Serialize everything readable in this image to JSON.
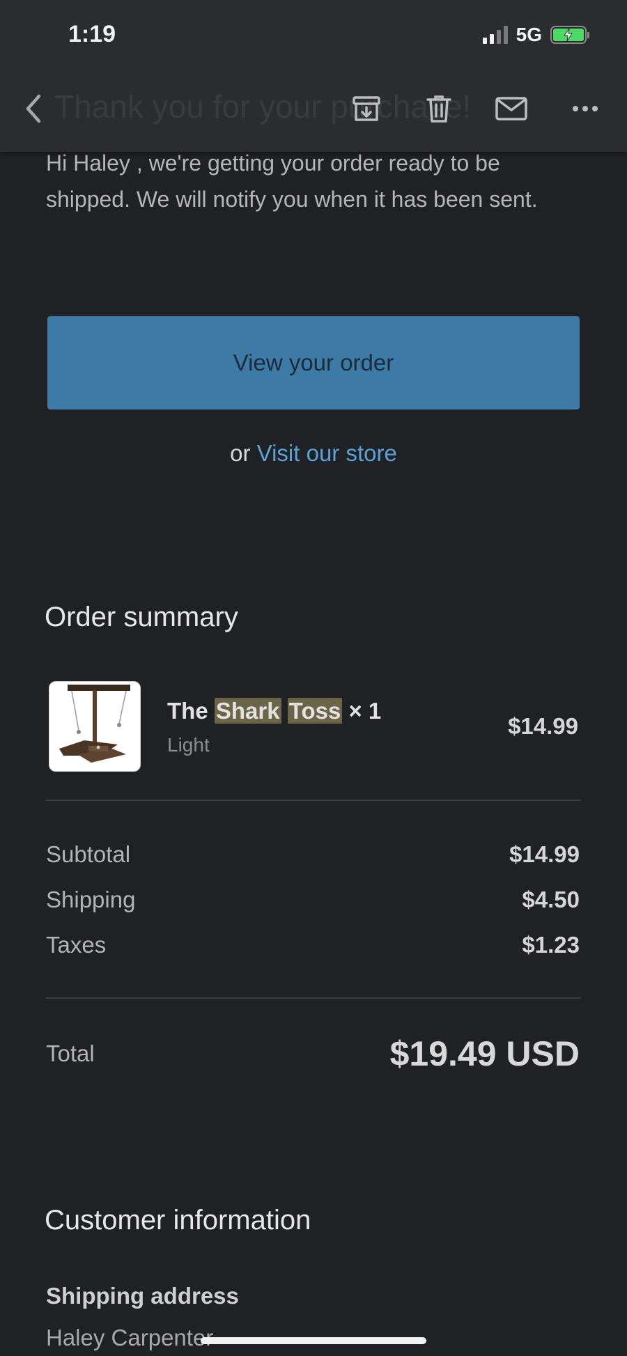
{
  "status_bar": {
    "time": "1:19",
    "network": "5G",
    "battery": "charging"
  },
  "toolbar": {
    "subject": "Thank you for your purchase!",
    "icons": [
      "back-icon",
      "archive-icon",
      "trash-icon",
      "mail-icon",
      "more-icon"
    ]
  },
  "email": {
    "intro": "Hi Haley , we're getting your order ready to be shipped. We will notify you when it has been sent.",
    "view_order_label": "View your order",
    "or_text": "or",
    "visit_store_label": "Visit our store",
    "order_summary_title": "Order summary",
    "product": {
      "name_prefix": "The",
      "name_highlight_1": "Shark",
      "name_highlight_2": "Toss",
      "quantity": "× 1",
      "variant": "Light",
      "price": "$14.99"
    },
    "totals": {
      "subtotal_label": "Subtotal",
      "subtotal_value": "$14.99",
      "shipping_label": "Shipping",
      "shipping_value": "$4.50",
      "taxes_label": "Taxes",
      "taxes_value": "$1.23",
      "total_label": "Total",
      "total_value": "$19.49 USD"
    },
    "customer_info_title": "Customer information",
    "shipping_address_label": "Shipping address",
    "shipping_name": "Haley Carpenter"
  },
  "colors": {
    "background": "#202124",
    "button": "#3d7aa6",
    "link": "#5aa3d6",
    "highlight": "#6b6447"
  }
}
